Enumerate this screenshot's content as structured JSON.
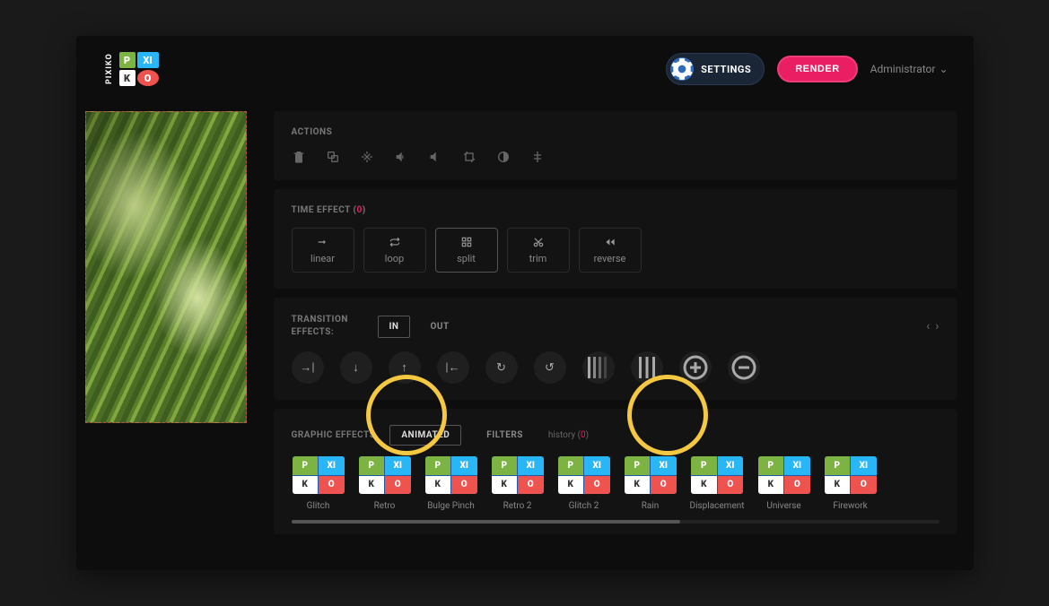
{
  "header": {
    "settings_label": "SETTINGS",
    "render_label": "RENDER",
    "user_label": "Administrator"
  },
  "actions": {
    "title": "ACTIONS"
  },
  "time_effect": {
    "title_prefix": "TIME EFFECT (",
    "count": "0",
    "title_suffix": ")",
    "items": [
      {
        "label": "linear",
        "selected": false
      },
      {
        "label": "loop",
        "selected": false
      },
      {
        "label": "split",
        "selected": true
      },
      {
        "label": "trim",
        "selected": false
      },
      {
        "label": "reverse",
        "selected": false
      }
    ]
  },
  "transition": {
    "title_line1": "TRANSITION",
    "title_line2": "EFFECTS:",
    "in_label": "IN",
    "out_label": "OUT"
  },
  "graphic_effects": {
    "title": "GRAPHIC EFFECTS",
    "tab_animated": "ANIMATED",
    "tab_filters": "FILTERS",
    "history_prefix": "history (",
    "history_count": "0",
    "history_suffix": ")",
    "items": [
      "Glitch",
      "Retro",
      "Bulge Pinch",
      "Retro 2",
      "Glitch 2",
      "Rain",
      "Displacement",
      "Universe",
      "Firework"
    ]
  }
}
